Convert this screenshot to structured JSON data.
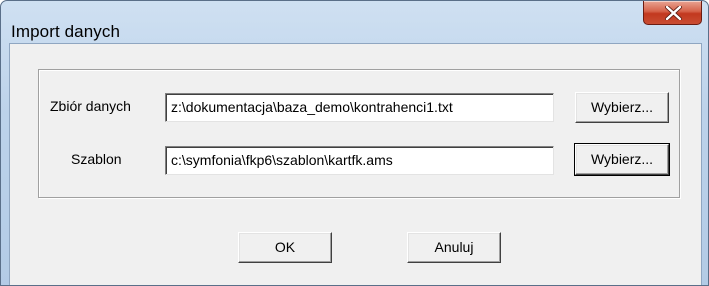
{
  "window": {
    "title": "Import danych",
    "close_icon": "close-icon"
  },
  "form": {
    "rows": [
      {
        "label": "Zbiór danych",
        "value": "z:\\dokumentacja\\baza_demo\\kontrahenci1.txt",
        "button": "Wybierz..."
      },
      {
        "label": "Szablon",
        "value": "c:\\symfonia\\fkp6\\szablon\\kartfk.ams",
        "button": "Wybierz..."
      }
    ]
  },
  "actions": {
    "ok": "OK",
    "cancel": "Anuluj"
  }
}
